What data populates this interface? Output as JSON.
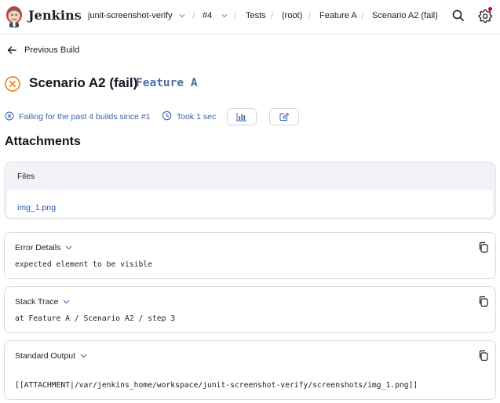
{
  "header": {
    "brand": "Jenkins",
    "breadcrumbs": [
      {
        "label": "junit-screenshot-verify",
        "has_menu": true
      },
      {
        "label": "#4",
        "has_menu": true
      },
      {
        "label": "Tests"
      },
      {
        "label": "(root)"
      },
      {
        "label": "Feature A"
      },
      {
        "label": "Scenario A2 (fail)"
      }
    ],
    "icons": [
      "search-icon",
      "settings-icon"
    ],
    "notification_color": "#e6001f"
  },
  "nav": {
    "previous_build": "Previous Build"
  },
  "test": {
    "status": "failed",
    "status_icon": "x-circle-icon",
    "name": "Scenario A2 (fail)",
    "suite": "Feature A",
    "failing_text": "Failing for the past 4 builds since #1",
    "took_text": "Took 1 sec",
    "buttons": [
      "history-chart-icon",
      "edit-description-icon"
    ]
  },
  "attachments": {
    "heading": "Attachments",
    "files_label": "Files",
    "files": [
      "img_1.png"
    ]
  },
  "sections": {
    "error": {
      "title": "Error Details",
      "text": "expected element to be visible"
    },
    "stack": {
      "title": "Stack Trace",
      "text": "at Feature A / Scenario A2 / step 3"
    },
    "stdout": {
      "title": "Standard Output",
      "text": "[[ATTACHMENT|/var/jenkins_home/workspace/junit-screenshot-verify/screenshots/img_1.png]]"
    }
  },
  "colors": {
    "fail": "#f08a2c",
    "link": "#2356ba",
    "info_text": "#3b62a6",
    "suite": "#4f6ea5"
  }
}
